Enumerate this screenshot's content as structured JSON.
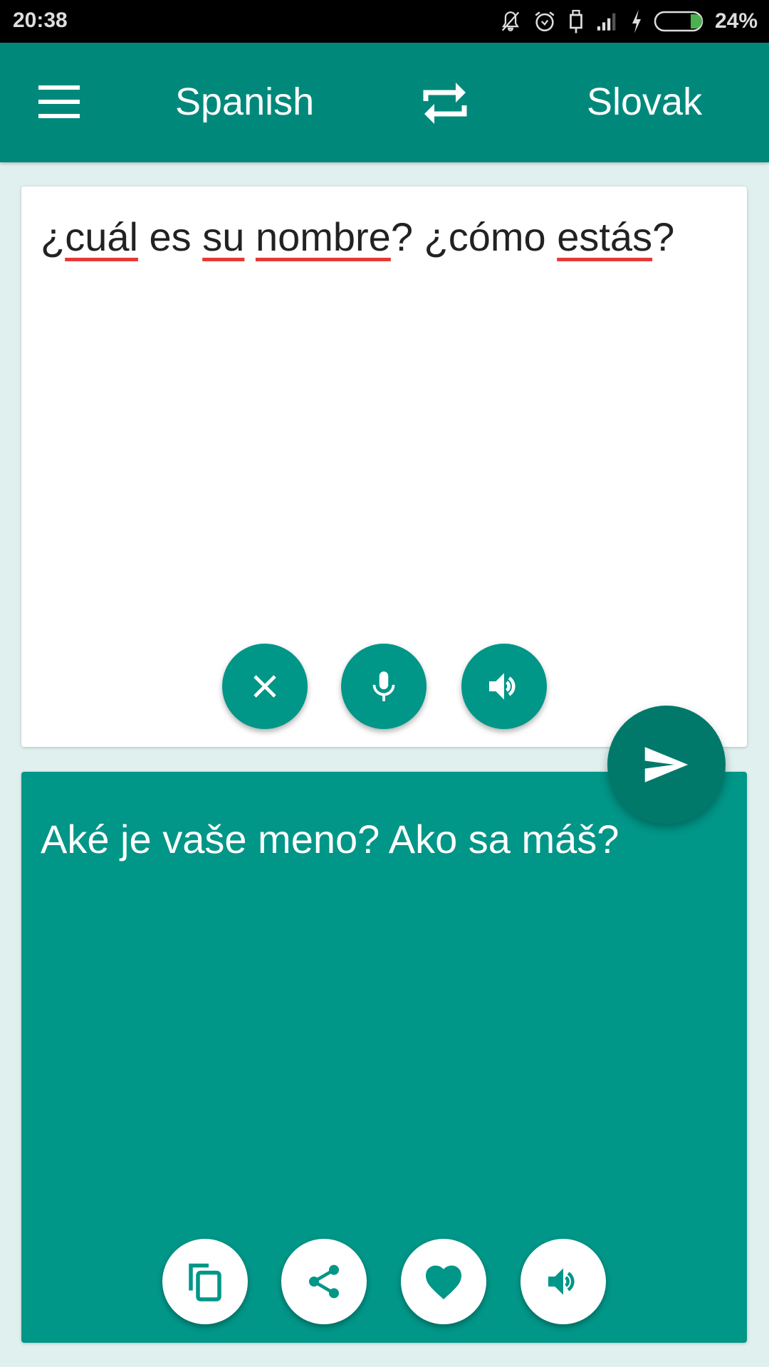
{
  "status_bar": {
    "time": "20:38",
    "battery_percent": "24%",
    "icons": [
      "notifications-off-icon",
      "alarm-icon",
      "usb-icon",
      "signal-icon",
      "charging-icon",
      "battery-icon"
    ]
  },
  "app_bar": {
    "menu_icon": "menu-icon",
    "source_language": "Spanish",
    "swap_icon": "swap-languages-icon",
    "target_language": "Slovak"
  },
  "input_card": {
    "words": [
      {
        "text": "¿",
        "misspelled": false
      },
      {
        "text": "cuál",
        "misspelled": true
      },
      {
        "text": " es ",
        "misspelled": false
      },
      {
        "text": "su",
        "misspelled": true
      },
      {
        "text": " ",
        "misspelled": false
      },
      {
        "text": "nombre",
        "misspelled": true
      },
      {
        "text": "? ¿cómo ",
        "misspelled": false
      },
      {
        "text": "estás",
        "misspelled": true
      },
      {
        "text": "?",
        "misspelled": false
      }
    ],
    "buttons": [
      "clear-icon",
      "microphone-icon",
      "speaker-icon"
    ]
  },
  "translate_button": {
    "icon": "send-icon"
  },
  "output_card": {
    "text": "Aké je vaše meno? Ako sa máš?",
    "buttons": [
      "copy-icon",
      "share-icon",
      "favorite-icon",
      "speaker-icon"
    ]
  },
  "colors": {
    "primary": "#009688",
    "primary_dark": "#00796b",
    "app_bar": "#00897b",
    "background": "#dff0ee",
    "spellcheck": "#e53935"
  }
}
